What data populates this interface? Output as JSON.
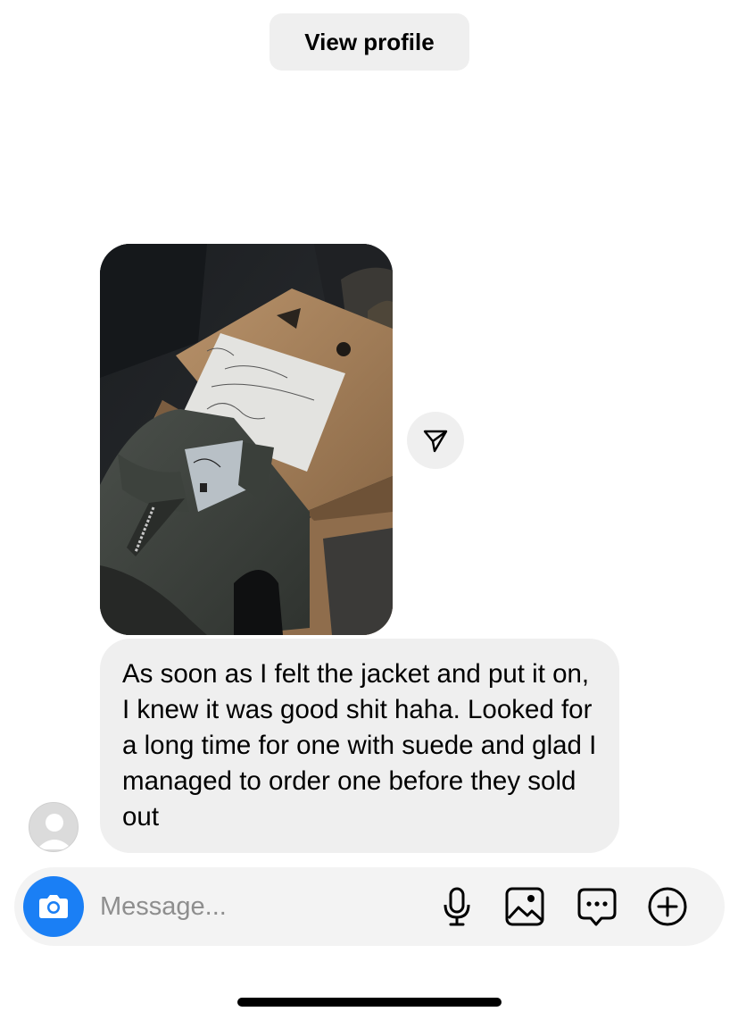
{
  "header": {
    "view_profile_label": "View profile"
  },
  "message": {
    "text": "As soon as I felt the jacket and put it on, I knew it was good shit haha. Looked for a long time for one with suede and glad I managed to order one before they sold out"
  },
  "composer": {
    "placeholder": "Message...",
    "icons": [
      "camera-icon",
      "microphone-icon",
      "gallery-icon",
      "sticker-chat-icon",
      "add-icon"
    ]
  },
  "colors": {
    "camera_button": "#1a7ff5",
    "bubble_background": "#efefef",
    "composer_background": "#f3f3f3",
    "placeholder_text": "#8e8e8e"
  }
}
